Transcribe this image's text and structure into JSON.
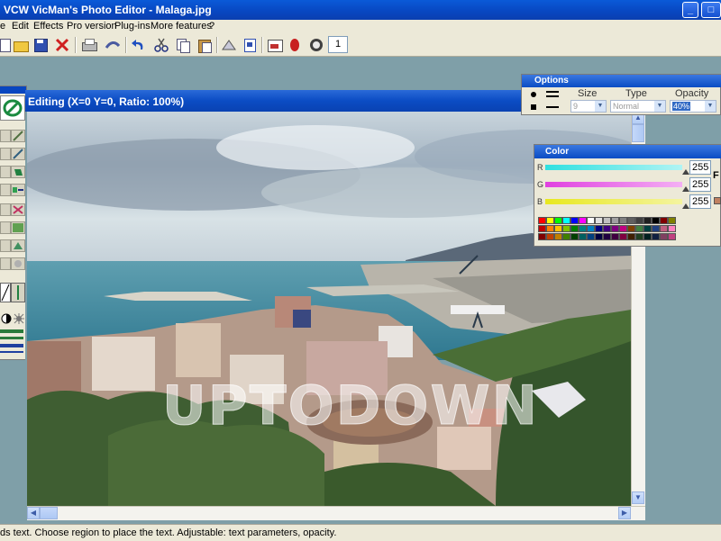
{
  "window": {
    "title": "VCW VicMan's Photo Editor - Malaga.jpg",
    "minimize": "_",
    "maximize": "□",
    "close": "×"
  },
  "menu": [
    "e",
    "Edit",
    "Effects",
    "Pro version",
    "Plug-ins",
    "More features",
    "?"
  ],
  "toolbar": {
    "page_number": "1"
  },
  "editor": {
    "title": "Editing (X=0 Y=0, Ratio: 100%)",
    "watermark": "UPTODOWN"
  },
  "options": {
    "title": "Options",
    "size_label": "Size",
    "type_label": "Type",
    "opacity_label": "Opacity",
    "size_value": "9",
    "type_value": "Normal",
    "opacity_value": "40%"
  },
  "color": {
    "title": "Color",
    "r_label": "R",
    "g_label": "G",
    "b_label": "B",
    "r_value": "255",
    "g_value": "255",
    "b_value": "255",
    "f_label": "F"
  },
  "status": {
    "text": "ds text. Choose region to place the text. Adjustable: text parameters, opacity."
  },
  "colors": {
    "accent": "#0846c0",
    "window_bg": "#ece9d8",
    "workspace": "#7f9fa8"
  }
}
